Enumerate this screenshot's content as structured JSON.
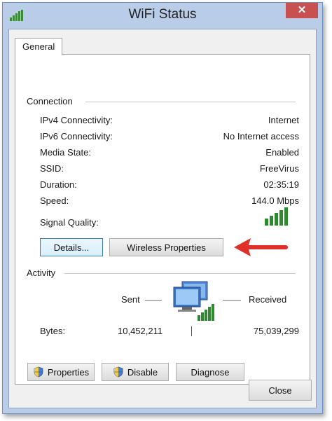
{
  "window": {
    "title": "WiFi Status",
    "close_label": "✕",
    "app_icon": "signal-bars-icon"
  },
  "tabs": [
    {
      "label": "General"
    }
  ],
  "connection": {
    "heading": "Connection",
    "rows": [
      {
        "label": "IPv4 Connectivity:",
        "value": "Internet"
      },
      {
        "label": "IPv6 Connectivity:",
        "value": "No Internet access"
      },
      {
        "label": "Media State:",
        "value": "Enabled"
      },
      {
        "label": "SSID:",
        "value": "FreeVirus"
      },
      {
        "label": "Duration:",
        "value": "02:35:19"
      },
      {
        "label": "Speed:",
        "value": "144.0 Mbps"
      }
    ],
    "signal_label": "Signal Quality:",
    "signal_icon": "signal-strength-icon",
    "signal_bars": 5,
    "details_button": "Details...",
    "wireless_button": "Wireless Properties"
  },
  "activity": {
    "heading": "Activity",
    "sent_label": "Sent",
    "received_label": "Received",
    "bytes_label": "Bytes:",
    "bytes_sent": "10,452,211",
    "bytes_received": "75,039,299",
    "network_icon": "network-computer-icon"
  },
  "actions": {
    "properties_button": "Properties",
    "disable_button": "Disable",
    "diagnose_button": "Diagnose"
  },
  "footer": {
    "close_button": "Close"
  },
  "colors": {
    "accent_arrow": "#e0302a",
    "signal_green": "#2f8a2f",
    "title_bar": "#b9cde8"
  }
}
